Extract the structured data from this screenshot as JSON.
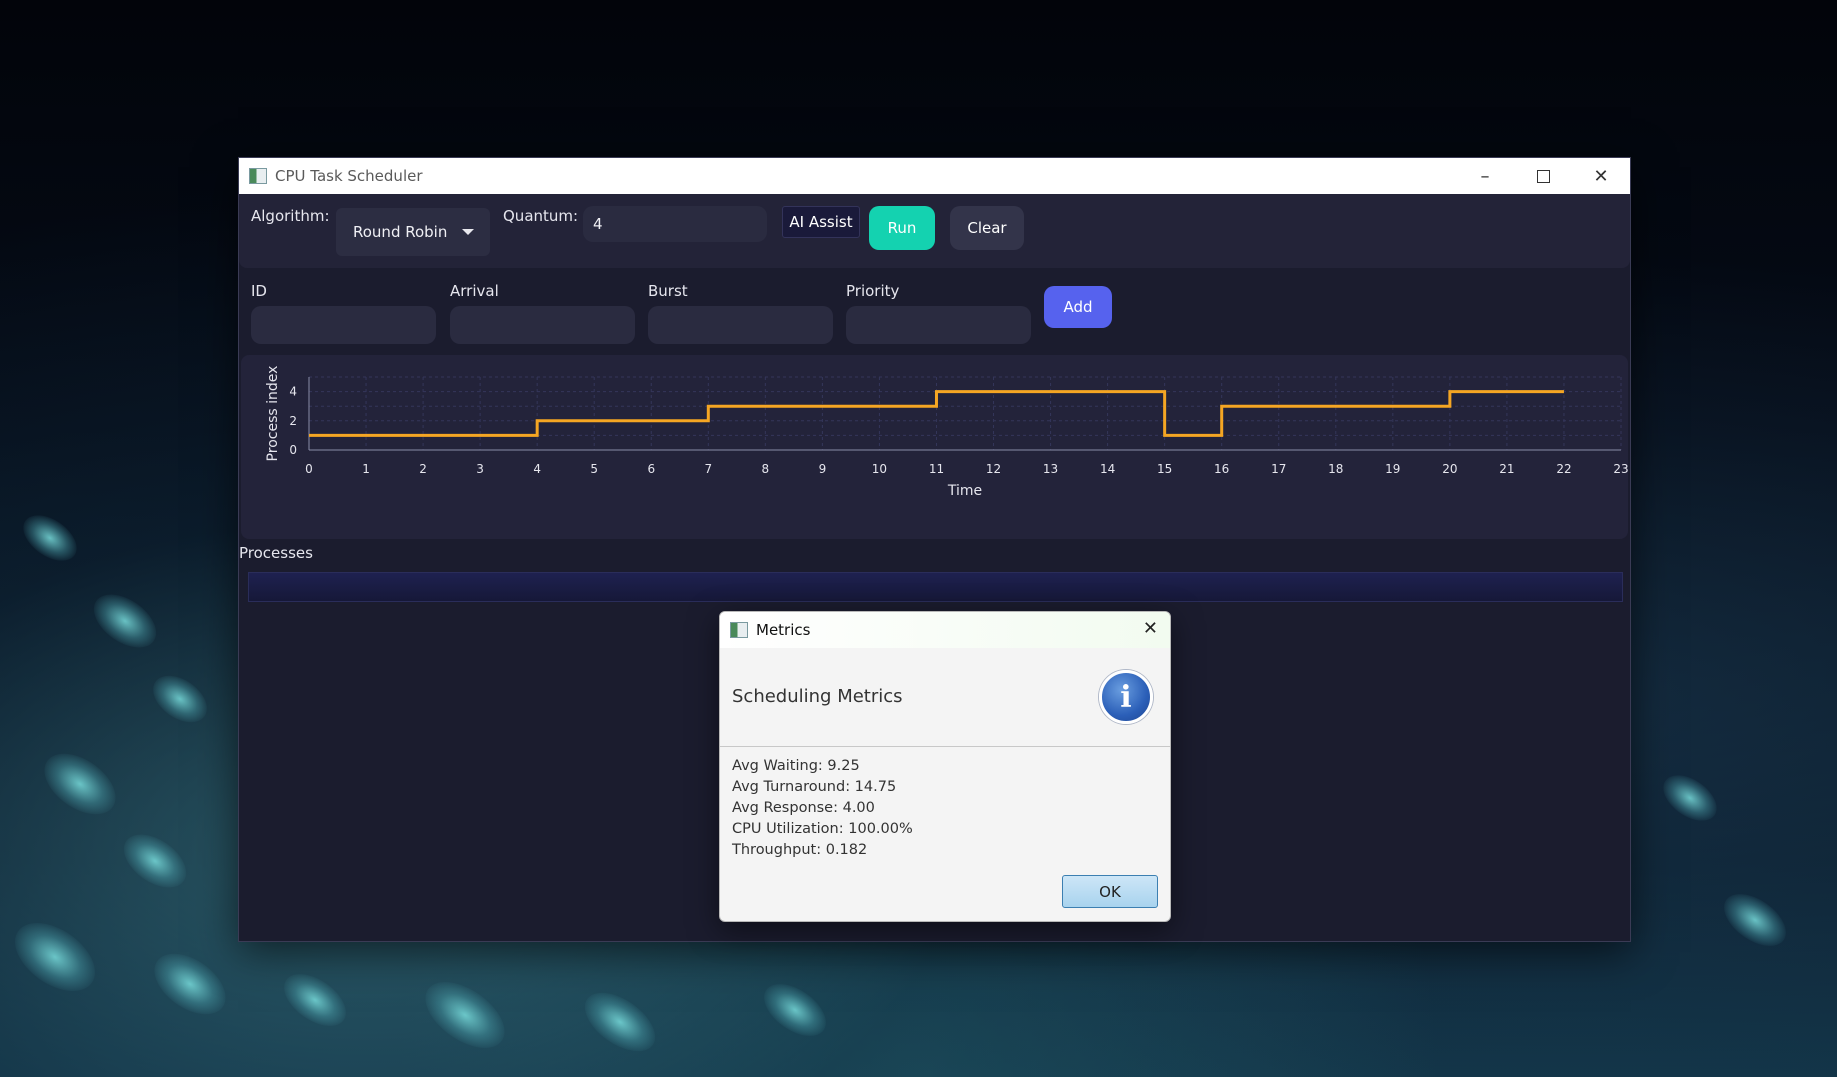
{
  "window": {
    "title": "CPU Task Scheduler"
  },
  "toolbar": {
    "algorithm_label": "Algorithm:",
    "algorithm_value": "Round Robin",
    "quantum_label": "Quantum:",
    "quantum_value": "4",
    "ai_assist_label": "AI Assist",
    "run_label": "Run",
    "clear_label": "Clear"
  },
  "form": {
    "id_label": "ID",
    "arrival_label": "Arrival",
    "burst_label": "Burst",
    "priority_label": "Priority",
    "add_label": "Add"
  },
  "processes_label": "Processes",
  "chart_data": {
    "type": "line",
    "step": true,
    "x": [
      0,
      4,
      4,
      7,
      7,
      11,
      11,
      15,
      15,
      16,
      16,
      20,
      20,
      22
    ],
    "y": [
      1,
      1,
      2,
      2,
      3,
      3,
      4,
      4,
      1,
      1,
      3,
      3,
      4,
      4
    ],
    "xlabel": "Time",
    "ylabel": "Process index",
    "xticks": [
      "0",
      "1",
      "2",
      "3",
      "4",
      "5",
      "6",
      "7",
      "8",
      "9",
      "10",
      "11",
      "12",
      "13",
      "14",
      "15",
      "16",
      "17",
      "18",
      "19",
      "20",
      "21",
      "22",
      "23"
    ],
    "yticks": [
      "0",
      "2",
      "4"
    ],
    "xlim": [
      0,
      23
    ],
    "ylim": [
      0,
      5
    ],
    "grid": true,
    "line_color": "#f5a623"
  },
  "dialog": {
    "title": "Metrics",
    "heading": "Scheduling Metrics",
    "metrics": [
      "Avg Waiting: 9.25",
      "Avg Turnaround: 14.75",
      "Avg Response: 4.00",
      "CPU Utilization: 100.00%",
      "Throughput: 0.182"
    ],
    "ok_label": "OK"
  },
  "colors": {
    "run_button": "#14d2b0",
    "add_button": "#5662ee",
    "clear_button": "#33344a"
  }
}
